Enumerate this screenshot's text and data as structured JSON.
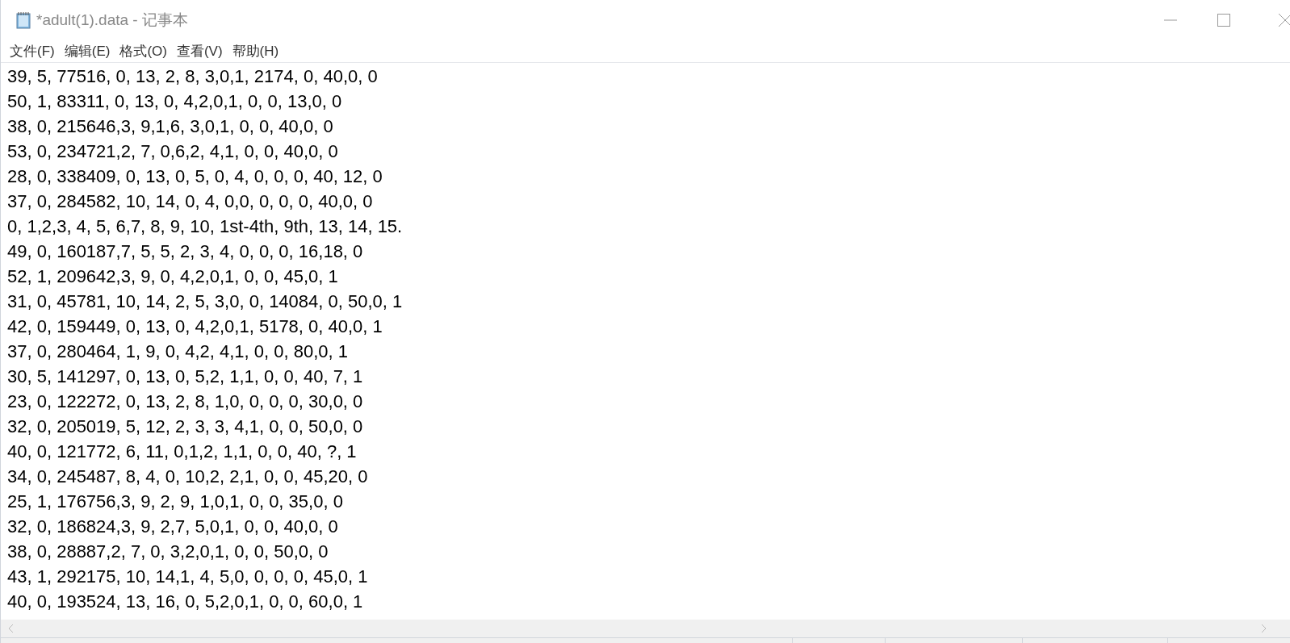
{
  "window": {
    "title": "*adult(1).data - 记事本"
  },
  "menu": [
    "文件(F)",
    "编辑(E)",
    "格式(O)",
    "查看(V)",
    "帮助(H)"
  ],
  "lines": [
    "39, 5, 77516, 0, 13, 2, 8, 3,0,1, 2174, 0, 40,0, 0",
    "50, 1, 83311, 0, 13, 0, 4,2,0,1, 0, 0, 13,0, 0",
    "38, 0, 215646,3, 9,1,6, 3,0,1, 0, 0, 40,0, 0",
    "53, 0, 234721,2, 7, 0,6,2, 4,1, 0, 0, 40,0, 0",
    "28, 0, 338409, 0, 13, 0, 5, 0, 4, 0, 0, 0, 40, 12, 0",
    "37, 0, 284582, 10, 14, 0, 4, 0,0, 0, 0, 0, 40,0, 0",
    "0, 1,2,3, 4, 5, 6,7, 8, 9, 10, 1st-4th, 9th, 13, 14, 15.",
    "49, 0, 160187,7, 5, 5, 2, 3, 4, 0, 0, 0, 16,18, 0",
    "52, 1, 209642,3, 9, 0, 4,2,0,1, 0, 0, 45,0, 1",
    "31, 0, 45781, 10, 14, 2, 5, 3,0, 0, 14084, 0, 50,0, 1",
    "42, 0, 159449, 0, 13, 0, 4,2,0,1, 5178, 0, 40,0, 1",
    "37, 0, 280464, 1, 9, 0, 4,2, 4,1, 0, 0, 80,0, 1",
    "30, 5, 141297, 0, 13, 0, 5,2, 1,1, 0, 0, 40, 7, 1",
    "23, 0, 122272, 0, 13, 2, 8, 1,0, 0, 0, 0, 30,0, 0",
    "32, 0, 205019, 5, 12, 2, 3, 3, 4,1, 0, 0, 50,0, 0",
    "40, 0, 121772, 6, 11, 0,1,2, 1,1, 0, 0, 40, ?, 1",
    "34, 0, 245487, 8, 4, 0, 10,2, 2,1, 0, 0, 45,20, 0",
    "25, 1, 176756,3, 9, 2, 9, 1,0,1, 0, 0, 35,0, 0",
    "32, 0, 186824,3, 9, 2,7, 5,0,1, 0, 0, 40,0, 0",
    "38, 0, 28887,2, 7, 0, 3,2,0,1, 0, 0, 50,0, 0",
    "43, 1, 292175, 10, 14,1, 4, 5,0, 0, 0, 0, 45,0, 1",
    "40, 0, 193524, 13, 16, 0, 5,2,0,1, 0, 0, 60,0, 1"
  ]
}
